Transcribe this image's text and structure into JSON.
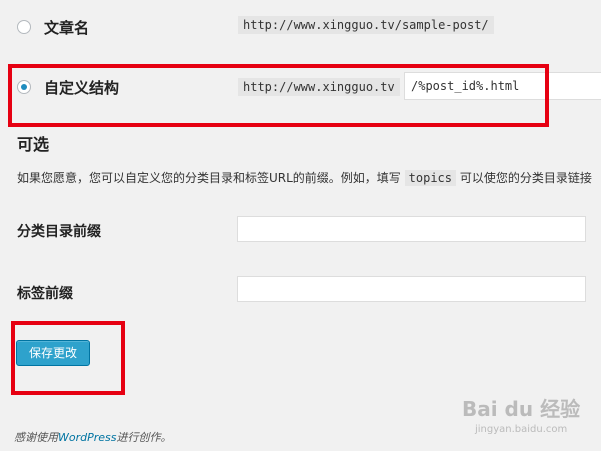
{
  "permalink_options": [
    {
      "label": "文章名",
      "example": "http://www.xingguo.tv/sample-post/",
      "checked": false
    },
    {
      "label": "自定义结构",
      "example": "http://www.xingguo.tv",
      "input_value": "/%post_id%.html",
      "checked": true
    }
  ],
  "optional": {
    "title": "可选",
    "desc_before": "如果您愿意，您可以自定义您的分类目录和标签URL的前缀。例如，填写",
    "desc_keyword": "topics",
    "desc_after": "可以使您的分类目录链接",
    "category_prefix_label": "分类目录前缀",
    "category_prefix_value": "",
    "tag_prefix_label": "标签前缀",
    "tag_prefix_value": ""
  },
  "save_button_label": "保存更改",
  "footer": {
    "prefix": "感谢使用",
    "link": "WordPress",
    "suffix": "进行创作。"
  },
  "watermark": {
    "logo": "Bai du 经验",
    "url": "jingyan.baidu.com"
  },
  "colors": {
    "highlight_box": "#e60012",
    "button": "#2ea2cc",
    "background": "#f1f1f1"
  }
}
